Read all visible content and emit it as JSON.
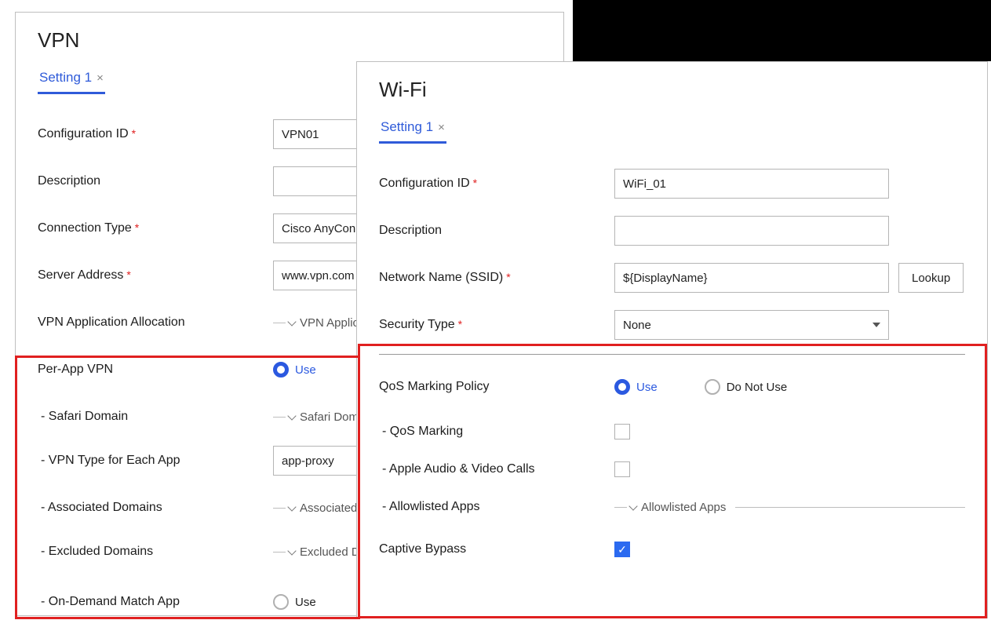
{
  "vpn": {
    "title": "VPN",
    "tab_label": "Setting 1",
    "fields": {
      "config_id": {
        "label": "Configuration ID",
        "required": true,
        "value": "VPN01"
      },
      "description": {
        "label": "Description",
        "required": false,
        "value": ""
      },
      "connection_type": {
        "label": "Connection Type",
        "required": true,
        "value": "Cisco AnyConn"
      },
      "server_address": {
        "label": "Server Address",
        "required": true,
        "value": "www.vpn.com"
      },
      "app_allocation": {
        "label": "VPN Application Allocation",
        "collapsed_legend": "VPN Applica"
      },
      "per_app_vpn": {
        "label": "Per-App VPN",
        "options": [
          "Use"
        ],
        "selected": "Use"
      },
      "safari_domain": {
        "label": "- Safari Domain",
        "collapsed_legend": "Safari Doma"
      },
      "vpn_type_each_app": {
        "label": "- VPN Type for Each App",
        "value": "app-proxy"
      },
      "associated_domains": {
        "label": "- Associated Domains",
        "collapsed_legend": "Associated D"
      },
      "excluded_domains": {
        "label": "- Excluded Domains",
        "collapsed_legend": "Excluded Do"
      },
      "on_demand_match_app": {
        "label": "- On-Demand Match App",
        "options": [
          "Use"
        ],
        "selected": null
      }
    }
  },
  "wifi": {
    "title": "Wi-Fi",
    "tab_label": "Setting 1",
    "fields": {
      "config_id": {
        "label": "Configuration ID",
        "required": true,
        "value": "WiFi_01"
      },
      "description": {
        "label": "Description",
        "required": false,
        "value": ""
      },
      "ssid": {
        "label": "Network Name (SSID)",
        "required": true,
        "value": "${DisplayName}",
        "lookup_label": "Lookup"
      },
      "security_type": {
        "label": "Security Type",
        "required": true,
        "value": "None"
      },
      "qos_marking_policy": {
        "label": "QoS Marking Policy",
        "options": [
          "Use",
          "Do Not Use"
        ],
        "selected": "Use"
      },
      "qos_marking": {
        "label": "- QoS Marking",
        "checked": false
      },
      "apple_av_calls": {
        "label": "- Apple Audio & Video Calls",
        "checked": false
      },
      "allowlisted_apps": {
        "label": "- Allowlisted Apps",
        "collapsed_legend": "Allowlisted Apps"
      },
      "captive_bypass": {
        "label": "Captive Bypass",
        "checked": true
      }
    }
  }
}
